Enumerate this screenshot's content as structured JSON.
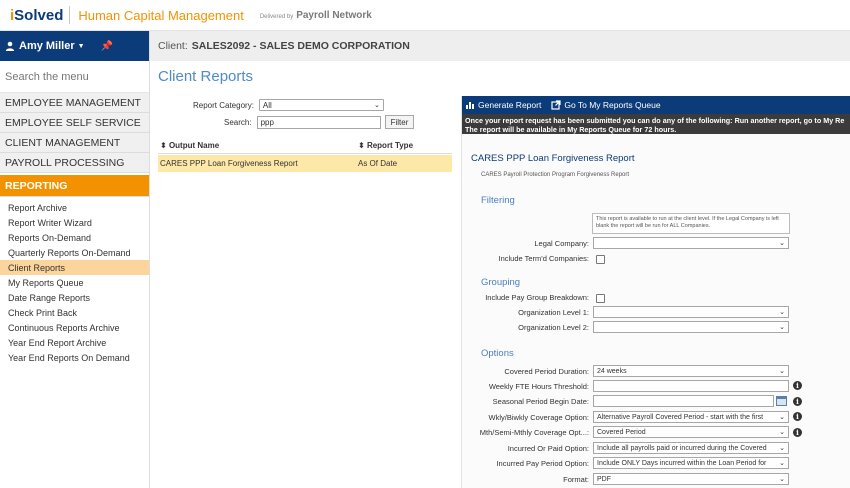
{
  "header": {
    "brand_i": "i",
    "brand_rest": "Solved",
    "product": "Human Capital Management",
    "delivered_by": "Delivered by",
    "delivered_name": "Payroll Network"
  },
  "sidebar": {
    "user_name": "Amy Miller",
    "search_placeholder": "Search the menu",
    "sections": [
      {
        "label": "EMPLOYEE MANAGEMENT"
      },
      {
        "label": "EMPLOYEE SELF SERVICE"
      },
      {
        "label": "CLIENT MANAGEMENT"
      },
      {
        "label": "PAYROLL PROCESSING"
      }
    ],
    "active_section": "REPORTING",
    "submenu": [
      {
        "label": "Report Archive"
      },
      {
        "label": "Report Writer Wizard"
      },
      {
        "label": "Reports On-Demand"
      },
      {
        "label": "Quarterly Reports On-Demand"
      },
      {
        "label": "Client Reports"
      },
      {
        "label": "My Reports Queue"
      },
      {
        "label": "Date Range Reports"
      },
      {
        "label": "Check Print Back"
      },
      {
        "label": "Continuous Reports Archive"
      },
      {
        "label": "Year End Report Archive"
      },
      {
        "label": "Year End Reports On Demand"
      }
    ]
  },
  "clientbar": {
    "prefix": "Client:",
    "client": "SALES2092 - SALES DEMO CORPORATION"
  },
  "page_title": "Client Reports",
  "filters": {
    "category_label": "Report Category:",
    "category_value": "All",
    "search_label": "Search:",
    "search_value": "ppp",
    "filter_button": "Filter"
  },
  "results": {
    "col_output": "Output Name",
    "col_type": "Report Type",
    "rows": [
      {
        "name": "CARES PPP Loan Forgiveness Report",
        "type": "As Of Date"
      }
    ]
  },
  "right_panel": {
    "generate_label": "Generate Report",
    "queue_label": "Go To My Reports Queue",
    "notice_line1": "Once your report request has been submitted you can do any of the following: Run another report, go to My Re",
    "notice_line2": "The report will be available in My Reports Queue for 72 hours.",
    "report_title": "CARES PPP Loan Forgiveness Report",
    "report_desc": "CARES Payroll Protection Program Forgiveness Report",
    "filtering_heading": "Filtering",
    "filtering_note": "This report is available to run at the client level. If the Legal Company is left blank the report will be run for ALL Companies.",
    "legal_company_label": "Legal Company:",
    "include_termd_label": "Include Term'd Companies:",
    "grouping_heading": "Grouping",
    "include_pay_group_label": "Include Pay Group Breakdown:",
    "org_level1_label": "Organization Level 1:",
    "org_level2_label": "Organization Level 2:",
    "options_heading": "Options",
    "covered_period_label": "Covered Period Duration:",
    "covered_period_value": "24 weeks",
    "fte_threshold_label": "Weekly FTE Hours Threshold:",
    "seasonal_label": "Seasonal Period Begin Date:",
    "wkly_label": "Wkly/Biwkly Coverage Option:",
    "wkly_value": "Alternative Payroll Covered Period - start with the first",
    "mth_label": "Mth/Semi-Mthly Coverage Opt...:",
    "mth_value": "Covered Period",
    "incurred_label": "Incurred Or Paid Option:",
    "incurred_value": "Include all payrolls paid or incurred during the Covered",
    "incurred_pay_label": "Incurred Pay Period Option:",
    "incurred_pay_value": "Include ONLY Days incurred within the Loan Period for",
    "format_label": "Format:",
    "format_value": "PDF"
  }
}
